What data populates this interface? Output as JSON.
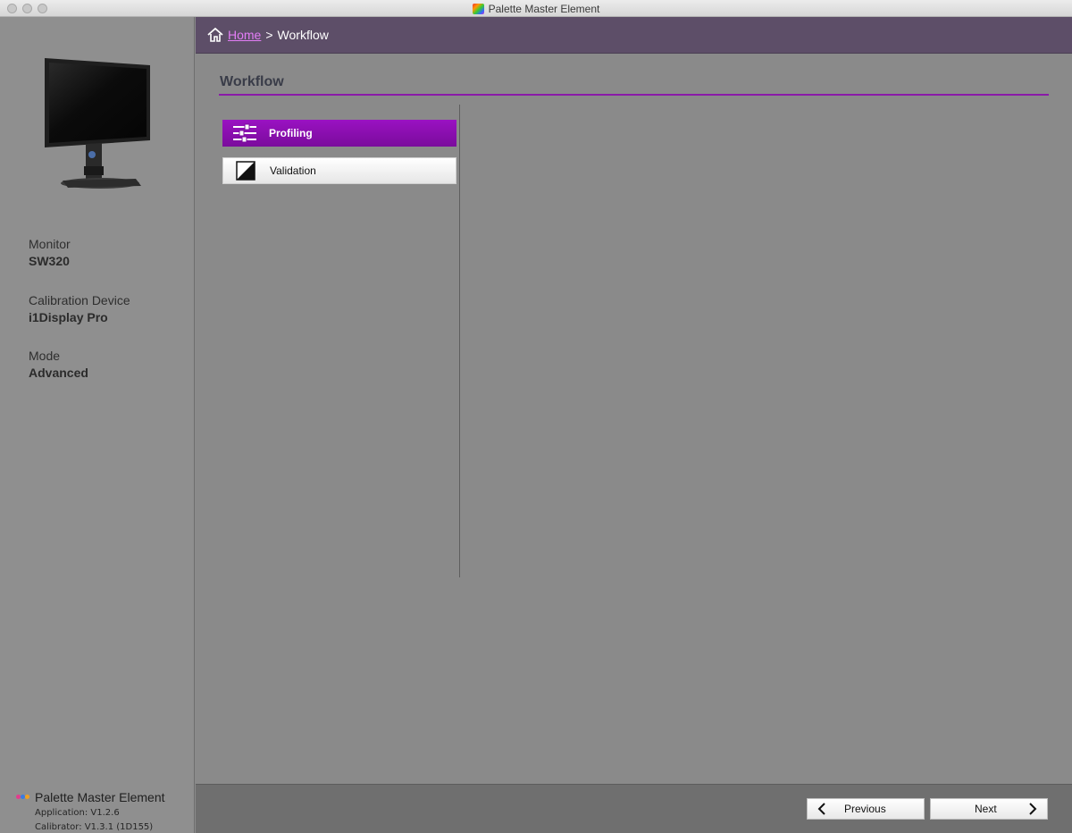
{
  "window": {
    "title": "Palette Master Element"
  },
  "breadcrumb": {
    "home": "Home",
    "separator": ">",
    "current": "Workflow"
  },
  "page": {
    "title": "Workflow"
  },
  "workflow": {
    "items": [
      {
        "label": "Profiling",
        "icon": "profiling-sliders-icon",
        "active": true
      },
      {
        "label": "Validation",
        "icon": "validation-icon",
        "active": false
      }
    ]
  },
  "sidebar": {
    "monitor_label": "Monitor",
    "monitor_value": "SW320",
    "device_label": "Calibration Device",
    "device_value": "i1Display Pro",
    "mode_label": "Mode",
    "mode_value": "Advanced",
    "brand_name": "Palette Master Element",
    "application_version": "Application: V1.2.6",
    "calibrator_version": "Calibrator: V1.3.1 (1D155)"
  },
  "footer": {
    "previous_label": "Previous",
    "next_label": "Next"
  },
  "colors": {
    "accent": "#8a1aa8",
    "header": "#5d4e68",
    "link": "#e27df5"
  }
}
